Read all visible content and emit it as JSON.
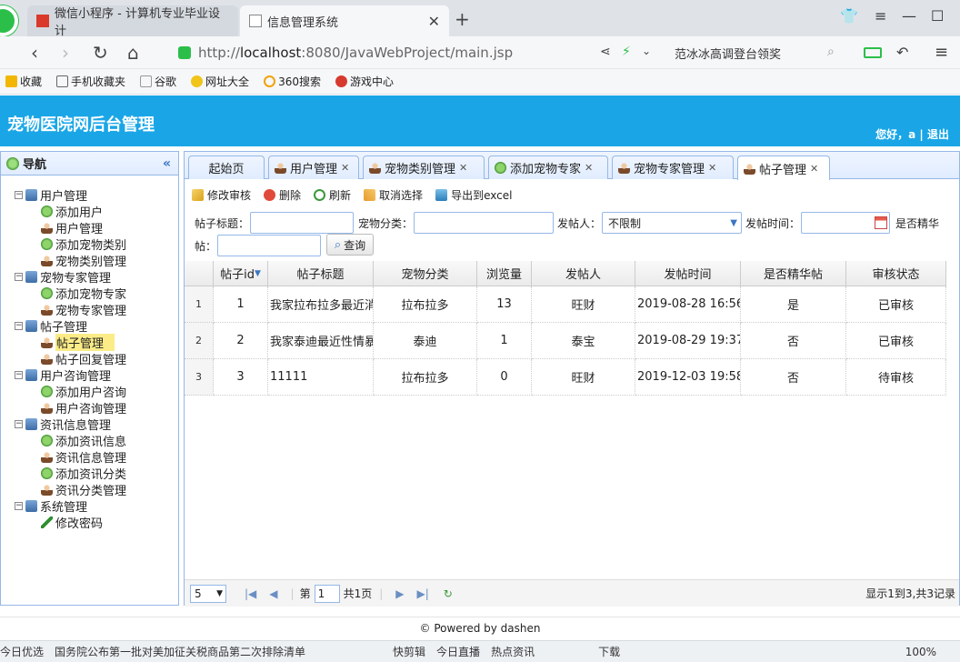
{
  "browser": {
    "tabs": [
      {
        "title": "微信小程序 - 计算机专业毕业设计",
        "active": false
      },
      {
        "title": "信息管理系统",
        "active": true
      }
    ],
    "url_prefix": "http://",
    "url_host": "localhost",
    "url_rest": ":8080/JavaWebProject/main.jsp",
    "hot_search": "范冰冰高调登台领奖",
    "bookmarks": [
      "收藏",
      "手机收藏夹",
      "谷歌",
      "网址大全",
      "360搜索",
      "游戏中心"
    ]
  },
  "app": {
    "title": "宠物医院网后台管理",
    "greeting": "您好，a | 退出"
  },
  "nav": {
    "title": "导航",
    "tree": [
      {
        "label": "用户管理",
        "level": 0,
        "icon": "folder"
      },
      {
        "label": "添加用户",
        "level": 1,
        "icon": "add"
      },
      {
        "label": "用户管理",
        "level": 1,
        "icon": "user"
      },
      {
        "label": "添加宠物类别",
        "level": 1,
        "icon": "add"
      },
      {
        "label": "宠物类别管理",
        "level": 1,
        "icon": "user"
      },
      {
        "label": "宠物专家管理",
        "level": 0,
        "icon": "folder"
      },
      {
        "label": "添加宠物专家",
        "level": 1,
        "icon": "add"
      },
      {
        "label": "宠物专家管理",
        "level": 1,
        "icon": "user"
      },
      {
        "label": "帖子管理",
        "level": 0,
        "icon": "folder"
      },
      {
        "label": "帖子管理",
        "level": 1,
        "icon": "user",
        "selected": true
      },
      {
        "label": "帖子回复管理",
        "level": 1,
        "icon": "user"
      },
      {
        "label": "用户咨询管理",
        "level": 0,
        "icon": "folder"
      },
      {
        "label": "添加用户咨询",
        "level": 1,
        "icon": "add"
      },
      {
        "label": "用户咨询管理",
        "level": 1,
        "icon": "user"
      },
      {
        "label": "资讯信息管理",
        "level": 0,
        "icon": "folder"
      },
      {
        "label": "添加资讯信息",
        "level": 1,
        "icon": "add"
      },
      {
        "label": "资讯信息管理",
        "level": 1,
        "icon": "user"
      },
      {
        "label": "添加资讯分类",
        "level": 1,
        "icon": "add"
      },
      {
        "label": "资讯分类管理",
        "level": 1,
        "icon": "user"
      },
      {
        "label": "系统管理",
        "level": 0,
        "icon": "folder"
      },
      {
        "label": "修改密码",
        "level": 1,
        "icon": "pen"
      }
    ]
  },
  "content_tabs": [
    {
      "label": "起始页",
      "closable": false
    },
    {
      "label": "用户管理",
      "closable": true
    },
    {
      "label": "宠物类别管理",
      "closable": true
    },
    {
      "label": "添加宠物专家",
      "closable": true
    },
    {
      "label": "宠物专家管理",
      "closable": true
    },
    {
      "label": "帖子管理",
      "closable": true,
      "active": true
    }
  ],
  "toolbar": {
    "edit": "修改审核",
    "delete": "删除",
    "refresh": "刷新",
    "deselect": "取消选择",
    "export": "导出到excel"
  },
  "filters": {
    "title_label": "帖子标题：",
    "category_label": "宠物分类：",
    "poster_label": "发帖人：",
    "poster_value": "不限制",
    "time_label": "发帖时间：",
    "featured_label_1": "是否精华",
    "featured_label_2": "帖：",
    "query": "查询"
  },
  "grid": {
    "columns": [
      "帖子id",
      "帖子标题",
      "宠物分类",
      "浏览量",
      "发帖人",
      "发帖时间",
      "是否精华帖",
      "审核状态"
    ],
    "rows": [
      {
        "n": "1",
        "cells": [
          "1",
          "我家拉布拉多最近消",
          "拉布拉多",
          "13",
          "旺财",
          "2019-08-28 16:56",
          "是",
          "已审核"
        ]
      },
      {
        "n": "2",
        "cells": [
          "2",
          "我家泰迪最近性情暴",
          "泰迪",
          "1",
          "泰宝",
          "2019-08-29 19:37",
          "否",
          "已审核"
        ]
      },
      {
        "n": "3",
        "cells": [
          "3",
          "11111",
          "拉布拉多",
          "0",
          "旺财",
          "2019-12-03 19:58",
          "否",
          "待审核"
        ]
      }
    ]
  },
  "pager": {
    "page_size": "5",
    "page_prefix": "第",
    "page_value": "1",
    "page_total": "共1页",
    "info": "显示1到3,共3记录"
  },
  "footer": "© Powered by dashen",
  "statusbar": [
    "今日优选",
    "国务院公布第一批对美加征关税商品第二次排除清单",
    "快剪辑",
    "今日直播",
    "热点资讯",
    "下载",
    "100%"
  ]
}
